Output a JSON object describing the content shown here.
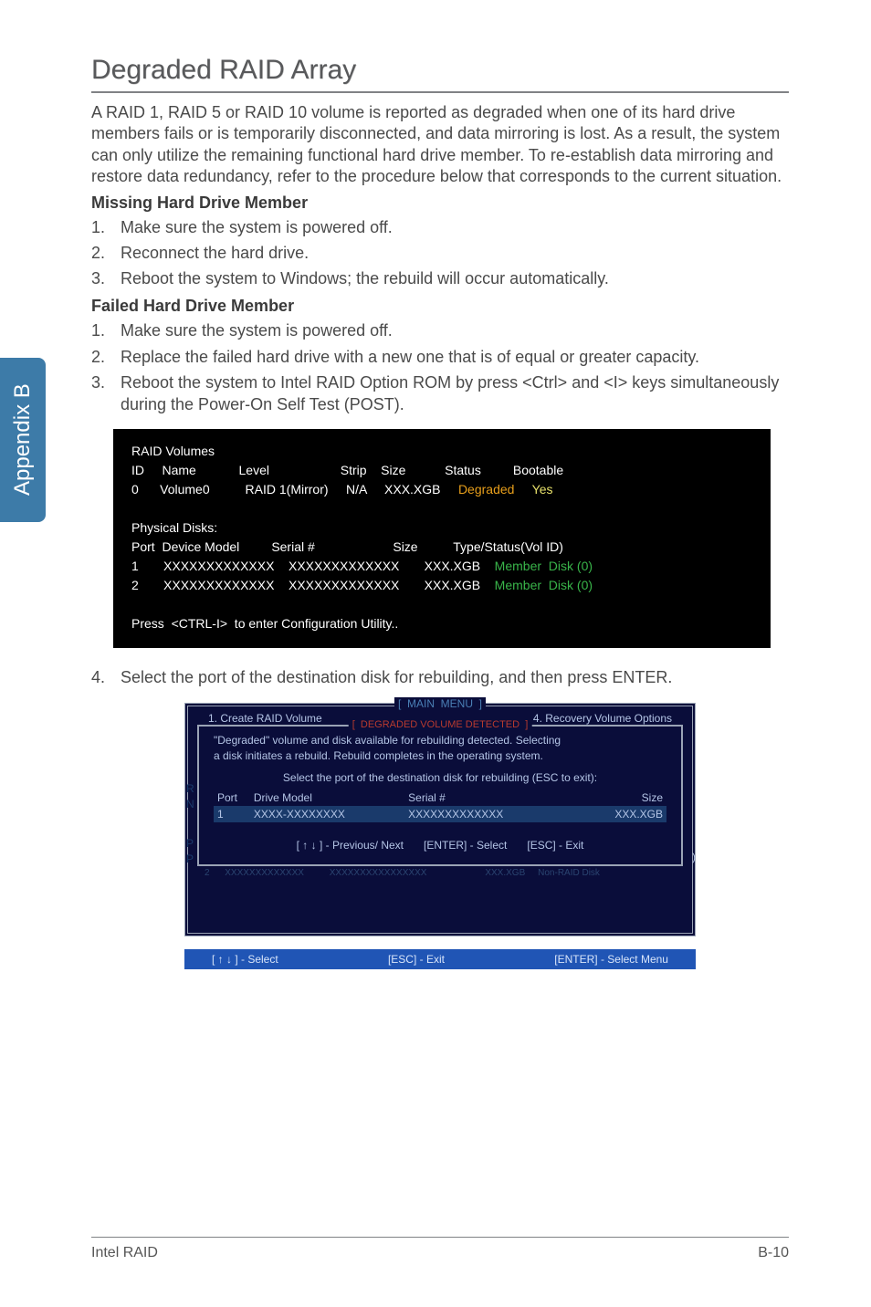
{
  "side_tab": "Appendix B",
  "title": "Degraded RAID Array",
  "intro": "A RAID 1, RAID 5 or RAID 10 volume is reported as degraded when one of its hard drive members fails or is temporarily disconnected, and data mirroring is lost. As a result, the system can only utilize the remaining functional hard drive member. To re-establish data mirroring and restore data redundancy, refer to the procedure below that corresponds to the current situation.",
  "missing": {
    "heading": "Missing Hard Drive Member",
    "steps": [
      "Make sure the system is powered off.",
      "Reconnect the hard drive.",
      "Reboot the system to Windows; the rebuild will occur automatically."
    ]
  },
  "failed": {
    "heading": "Failed Hard Drive Member",
    "steps": [
      "Make sure the system is powered off.",
      "Replace the failed hard drive with a new one that is of equal or greater capacity.",
      "Reboot the system to Intel RAID Option ROM by press <Ctrl> and <I> keys simultaneously during the Power-On Self Test (POST)."
    ]
  },
  "terminal": {
    "volumes_title": "RAID Volumes",
    "vol_headers": {
      "id": "ID",
      "name": "Name",
      "level": "Level",
      "strip": "Strip",
      "size": "Size",
      "status": "Status",
      "bootable": "Bootable"
    },
    "vol_row": {
      "id": "0",
      "name": "Volume0",
      "level": "RAID 1(Mirror)",
      "strip": "N/A",
      "size": "XXX.XGB",
      "status": "Degraded",
      "bootable": "Yes"
    },
    "disks_title": "Physical Disks:",
    "disk_headers": {
      "port": "Port",
      "model": "Device Model",
      "serial": "Serial #",
      "size": "Size",
      "type": "Type/Status(Vol ID)"
    },
    "disk_rows": [
      {
        "port": "1",
        "model": "XXXXXXXXXXXXX",
        "serial": "XXXXXXXXXXXXX",
        "size": "XXX.XGB",
        "type": "Member  Disk (0)"
      },
      {
        "port": "2",
        "model": "XXXXXXXXXXXXX",
        "serial": "XXXXXXXXXXXXX",
        "size": "XXX.XGB",
        "type": "Member  Disk (0)"
      }
    ],
    "prompt": "Press  <CTRL-I>  to enter Configuration Utility.."
  },
  "step4": "Select the port of the destination disk for rebuilding, and then press ENTER.",
  "dialog": {
    "main_menu": "[  MAIN  MENU  ]",
    "menu_left": "1.      Create  RAID  Volume",
    "menu_right": "4.      Recovery Volume  Options",
    "inner_title": "[  DEGRADED VOLUME DETECTED  ]",
    "line1": "\"Degraded\" volume and disk available for rebuilding detected. Selecting",
    "line2": "a disk initiates a rebuild. Rebuild completes in the  operating system.",
    "select_prompt": "Select the port of the destination disk for rebuilding (ESC to exit):",
    "cols": {
      "port": "Port",
      "model": "Drive  Model",
      "serial": "Serial  #",
      "size": "Size"
    },
    "row": {
      "port": "1",
      "model": "XXXX-XXXXXXXX",
      "serial": "XXXXXXXXXXXXX",
      "size": "XXX.XGB"
    },
    "hints": {
      "prev": "[ ↑ ↓ ] - Previous/ Next",
      "enter": "[ENTER] - Select",
      "esc": "[ESC] - Exit"
    },
    "bottom": {
      "select": "[ ↑ ↓ ] - Select",
      "esc": "[ESC] - Exit",
      "menu": "[ENTER] - Select Menu"
    }
  },
  "footer": {
    "left": "Intel RAID",
    "right": "B-10"
  }
}
